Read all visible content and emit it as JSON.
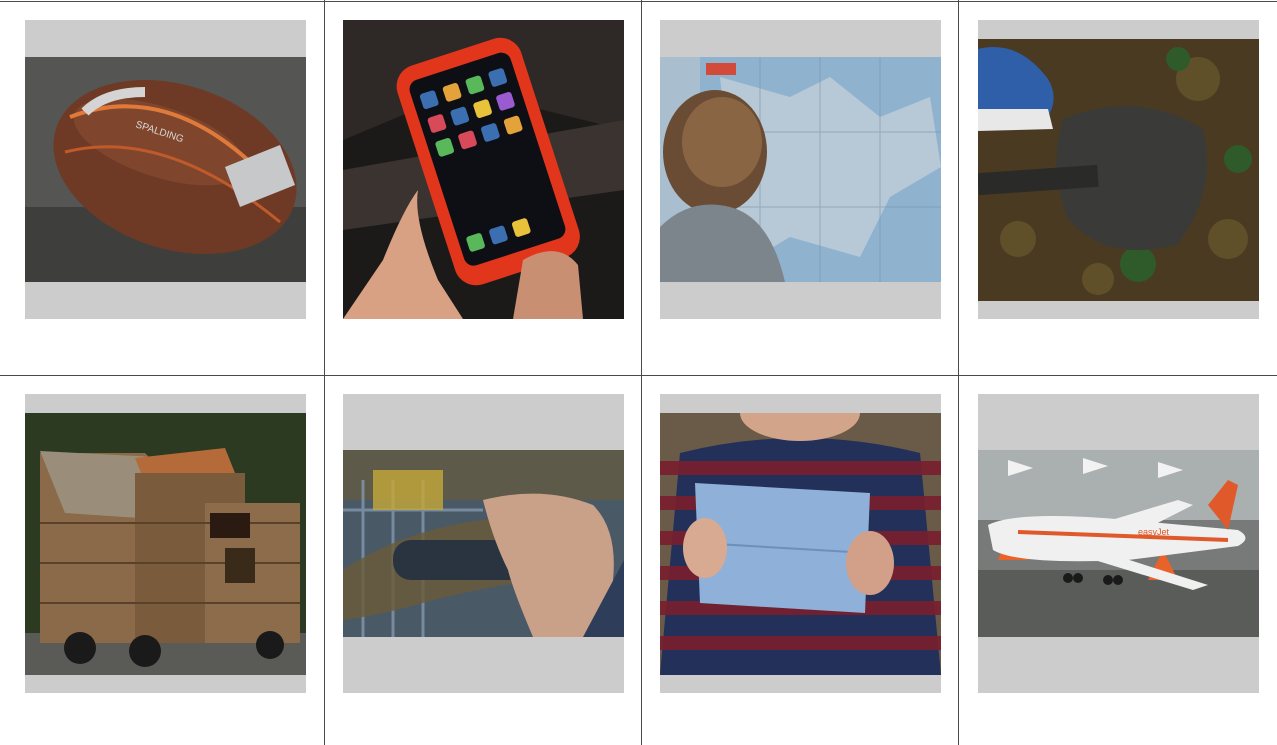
{
  "grid": {
    "rows": 2,
    "columns": 4,
    "tiles": [
      {
        "id": "football",
        "subject": "american-football-icon",
        "colors": {
          "main": "#6e3a25",
          "accent": "#c6c8ca",
          "bg": "#5a5a58"
        }
      },
      {
        "id": "phone",
        "subject": "smartphone-icon",
        "colors": {
          "main": "#e2361c",
          "accent": "#2a4a6a",
          "bg": "#1c1a19"
        }
      },
      {
        "id": "map",
        "subject": "map-reading-icon",
        "colors": {
          "main": "#7ea7c8",
          "accent": "#6a4b33",
          "bg": "#9fb7c9"
        }
      },
      {
        "id": "shovel",
        "subject": "shovel-digging-icon",
        "colors": {
          "main": "#3a3a38",
          "accent": "#2f5fa8",
          "bg": "#4a3a22"
        }
      },
      {
        "id": "cabin",
        "subject": "wooden-cabin-icon",
        "colors": {
          "main": "#8a6a48",
          "accent": "#b56a3a",
          "bg": "#2c3a22"
        }
      },
      {
        "id": "handle",
        "subject": "hand-holding-grip-icon",
        "colors": {
          "main": "#2a3440",
          "accent": "#6a5a38",
          "bg": "#495a66"
        }
      },
      {
        "id": "paper",
        "subject": "folded-paper-icon",
        "colors": {
          "main": "#8fb0d8",
          "accent": "#7a1f2e",
          "bg": "#23305a"
        }
      },
      {
        "id": "airplane",
        "subject": "toy-airplane-icon",
        "colors": {
          "main": "#f0f0f0",
          "accent": "#e0592a",
          "bg": "#777a78"
        }
      }
    ]
  }
}
